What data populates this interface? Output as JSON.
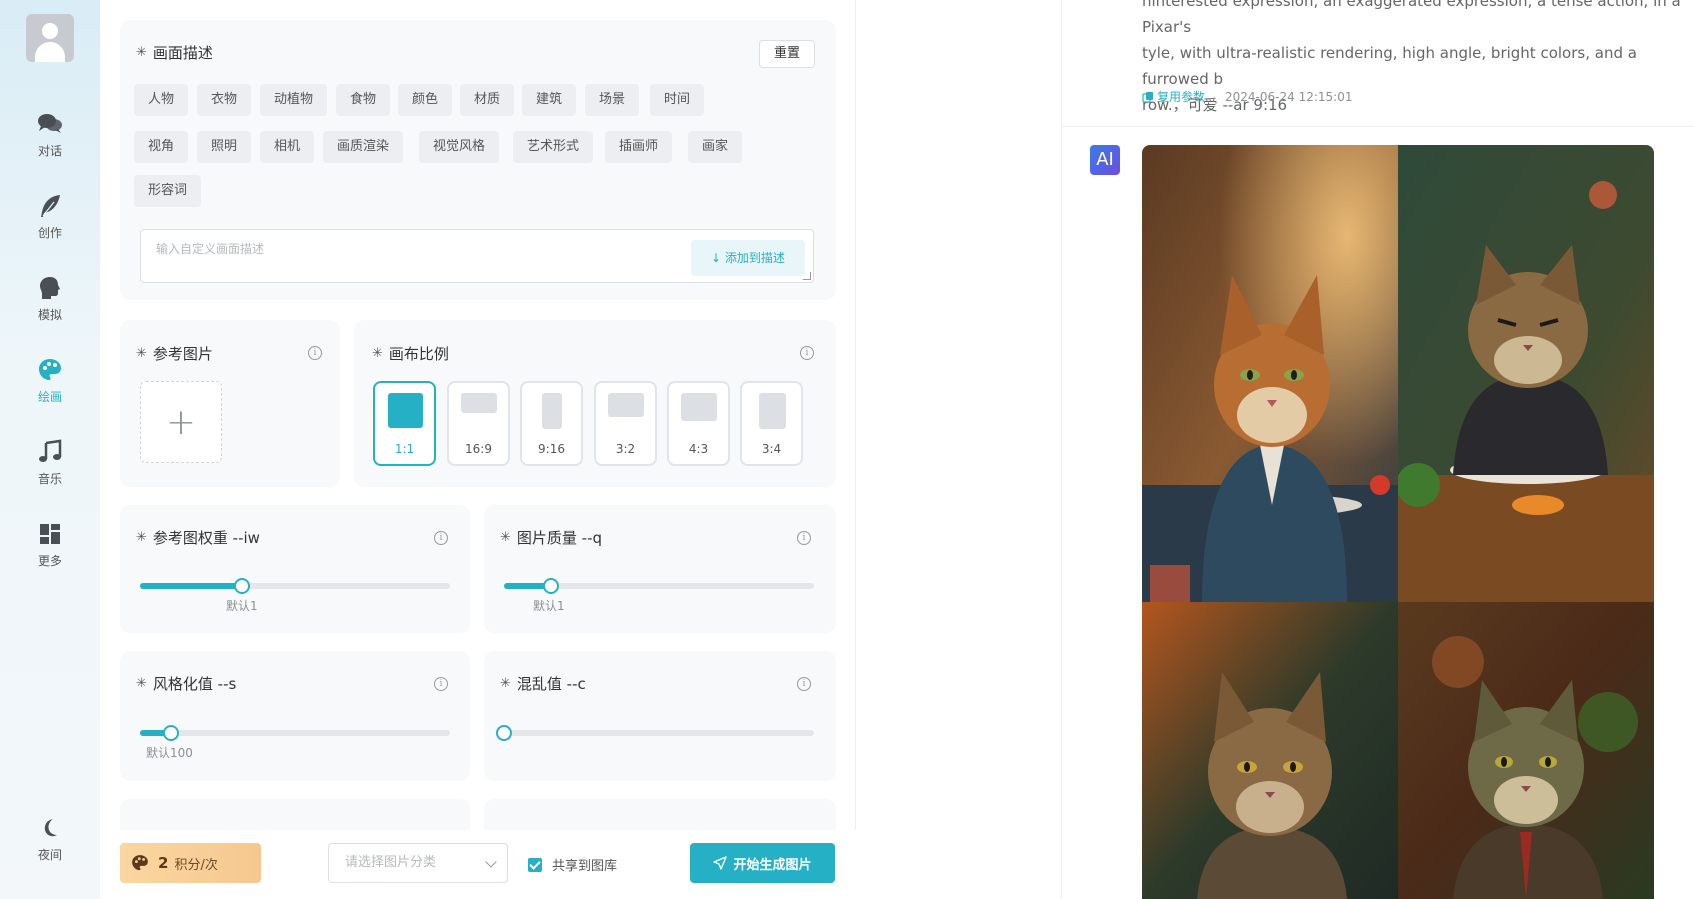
{
  "nav": {
    "items": [
      {
        "label": "对话",
        "icon": "chat-icon"
      },
      {
        "label": "创作",
        "icon": "feather-icon"
      },
      {
        "label": "模拟",
        "icon": "head-icon"
      },
      {
        "label": "绘画",
        "icon": "palette-icon"
      },
      {
        "label": "音乐",
        "icon": "music-icon"
      },
      {
        "label": "更多",
        "icon": "grid-icon"
      }
    ],
    "night_label": "夜间",
    "active_index": 3
  },
  "description": {
    "title": "画面描述",
    "reset_label": "重置",
    "tags": [
      "人物",
      "衣物",
      "动植物",
      "食物",
      "颜色",
      "材质",
      "建筑",
      "场景",
      "时间",
      "视角",
      "照明",
      "相机",
      "画质渲染",
      "视觉风格",
      "艺术形式",
      "插画师",
      "画家",
      "形容词"
    ],
    "input_placeholder": "输入自定义画面描述",
    "add_label": "添加到描述"
  },
  "reference": {
    "title": "参考图片",
    "upload_symbol": "+"
  },
  "canvas": {
    "title": "画布比例",
    "ratios": [
      "1:1",
      "16:9",
      "9:16",
      "3:2",
      "4:3",
      "3:4"
    ],
    "selected": "1:1"
  },
  "sliders": {
    "iw": {
      "title": "参考图权重 --iw",
      "default_label": "默认1",
      "value_fraction": 0.33
    },
    "q": {
      "title": "图片质量 --q",
      "default_label": "默认1",
      "value_fraction": 0.15
    },
    "s": {
      "title": "风格化值 --s",
      "default_label": "默认100",
      "value_fraction": 0.1
    },
    "c": {
      "title": "混乱值 --c",
      "value_fraction": 0.0
    }
  },
  "bottom": {
    "points_value": "2",
    "points_unit": "积分/次",
    "category_placeholder": "请选择图片分类",
    "share_label": "共享到图库",
    "share_checked": true,
    "generate_label": "开始生成图片"
  },
  "result": {
    "prompt_lines": [
      "hinterested expression, an exaggerated expression, a tense action, in a Pixar's",
      "tyle, with ultra-realistic rendering, high angle, bright colors, and a furrowed b",
      "row.，可爱 --ar 9:16"
    ],
    "reuse_label": "复用参数",
    "timestamp": "2024-06-24 12:15:01",
    "ai_label": "AI"
  },
  "colors": {
    "accent": "#26b0c6",
    "points_bg": "#f6c890"
  }
}
